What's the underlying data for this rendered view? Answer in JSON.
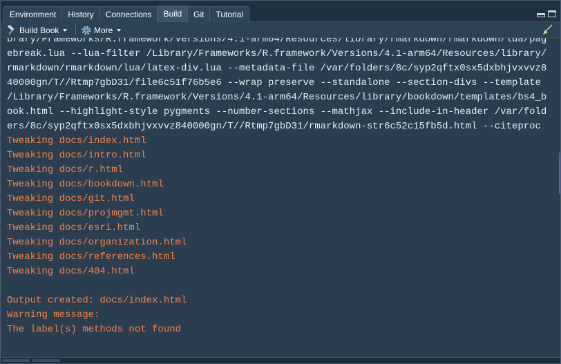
{
  "tabs": [
    {
      "label": "Environment",
      "active": false
    },
    {
      "label": "History",
      "active": false
    },
    {
      "label": "Connections",
      "active": false
    },
    {
      "label": "Build",
      "active": true
    },
    {
      "label": "Git",
      "active": false
    },
    {
      "label": "Tutorial",
      "active": false
    }
  ],
  "toolbar": {
    "build_label": "Build Book",
    "more_label": "More",
    "build_icon": "hammer-icon",
    "more_icon": "gear-icon",
    "clear_icon": "broom-icon"
  },
  "console": {
    "command_text": "brary/Frameworks/R.framework/Versions/4.1-arm64/Resources/library/rmarkdown/rmarkdown/lua/pagebreak.lua --lua-filter /Library/Frameworks/R.framework/Versions/4.1-arm64/Resources/library/rmarkdown/rmarkdown/lua/latex-div.lua --metadata-file /var/folders/8c/syp2qftx0sx5dxbhjvxvvz840000gn/T//Rtmp7gbD31/file6c51f76b5e6 --wrap preserve --standalone --section-divs --template /Library/Frameworks/R.framework/Versions/4.1-arm64/Resources/library/bookdown/templates/bs4_book.html --highlight-style pygments --number-sections --mathjax --include-in-header /var/folders/8c/syp2qftx0sx5dxbhjvxvvz840000gn/T//Rtmp7gbD31/rmarkdown-str6c52c15fb5d.html --citeproc",
    "tweak_lines": [
      "Tweaking docs/index.html",
      "Tweaking docs/intro.html",
      "Tweaking docs/r.html",
      "Tweaking docs/bookdown.html",
      "Tweaking docs/git.html",
      "Tweaking docs/projmgmt.html",
      "Tweaking docs/esri.html",
      "Tweaking docs/organization.html",
      "Tweaking docs/references.html",
      "Tweaking docs/404.html"
    ],
    "output_line": "Output created: docs/index.html",
    "warning_line": "Warning message:",
    "label_line": "The label(s) methods not found"
  },
  "colors": {
    "background": "#2b3e50",
    "command_text": "#e6ebef",
    "message_text": "#f0834e"
  }
}
